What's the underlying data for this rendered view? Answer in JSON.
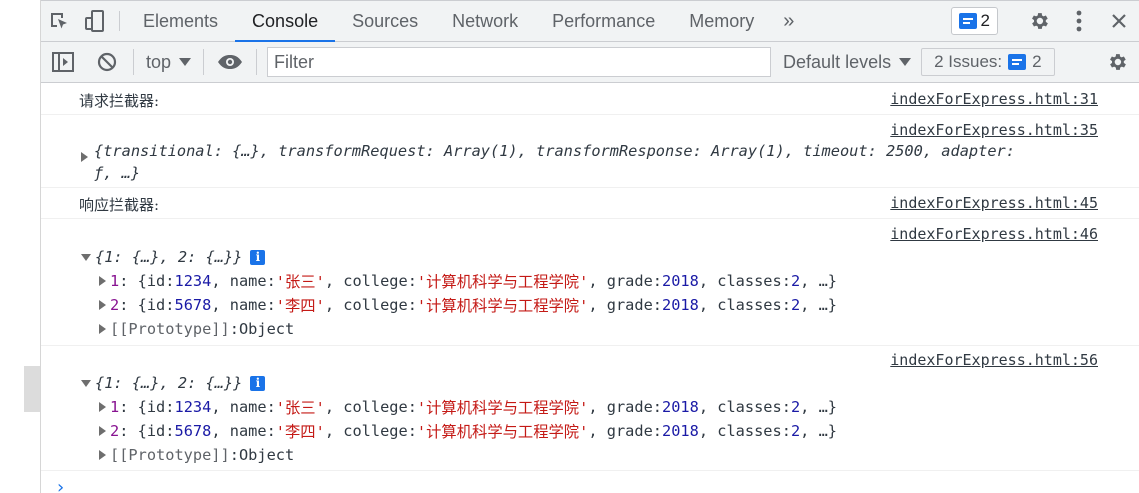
{
  "tabs": {
    "elements": "Elements",
    "console": "Console",
    "sources": "Sources",
    "network": "Network",
    "performance": "Performance",
    "memory": "Memory",
    "more": "»",
    "message_count": "2"
  },
  "toolbar": {
    "context": "top",
    "filter_placeholder": "Filter",
    "levels": "Default levels",
    "issues_label": "2 Issues:",
    "issues_count": "2"
  },
  "messages": [
    {
      "type": "log",
      "text": "请求拦截器:",
      "source": "indexForExpress.html:31"
    },
    {
      "type": "object",
      "source": "indexForExpress.html:35",
      "line1": "{transitional: {…}, transformRequest: Array(1), transformResponse: Array(1), timeout: 2500, adapter:",
      "line2": "ƒ, …}"
    },
    {
      "type": "log",
      "text": "响应拦截器:",
      "source": "indexForExpress.html:45"
    },
    {
      "type": "expanded",
      "source": "indexForExpress.html:46"
    },
    {
      "type": "expanded",
      "source": "indexForExpress.html:56"
    }
  ],
  "obj": {
    "summary": "{1: {…}, 2: {…}}",
    "row1": {
      "key": "1",
      "id": "1234",
      "name": "'张三'",
      "college": "'计算机科学与工程学院'",
      "grade": "2018",
      "classes": "2"
    },
    "row2": {
      "key": "2",
      "id": "5678",
      "name": "'李四'",
      "college": "'计算机科学与工程学院'",
      "grade": "2018",
      "classes": "2"
    },
    "proto_label": "[[Prototype]]",
    "proto_value": "Object"
  },
  "colors": {
    "accent": "#1a73e8",
    "string": "#c41a16",
    "number": "#1a1aa6",
    "key": "#881391"
  },
  "prompt": "›"
}
